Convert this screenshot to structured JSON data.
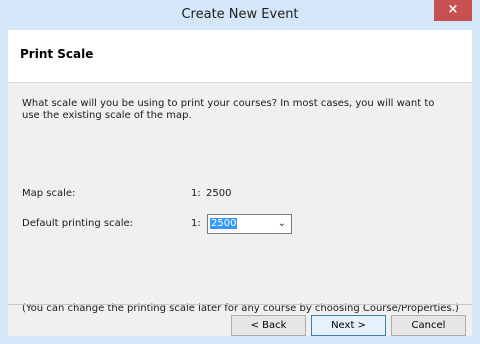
{
  "window": {
    "title": "Create New Event",
    "close_symbol": "×"
  },
  "header": {
    "title": "Print Scale"
  },
  "content": {
    "intro": "What scale will you be using to print your courses? In most cases, you will want to use the existing scale of the map.",
    "map_scale": {
      "label": "Map scale:",
      "prefix": "1:",
      "value": "2500"
    },
    "default_printing_scale": {
      "label": "Default printing scale:",
      "prefix": "1:",
      "selected_value": "2500"
    },
    "note": "(You can change the printing scale later for any course by choosing Course/Properties.)"
  },
  "buttons": {
    "back": "< Back",
    "next": "Next >",
    "cancel": "Cancel"
  },
  "icons": {
    "dropdown": "chevron-down-icon"
  }
}
